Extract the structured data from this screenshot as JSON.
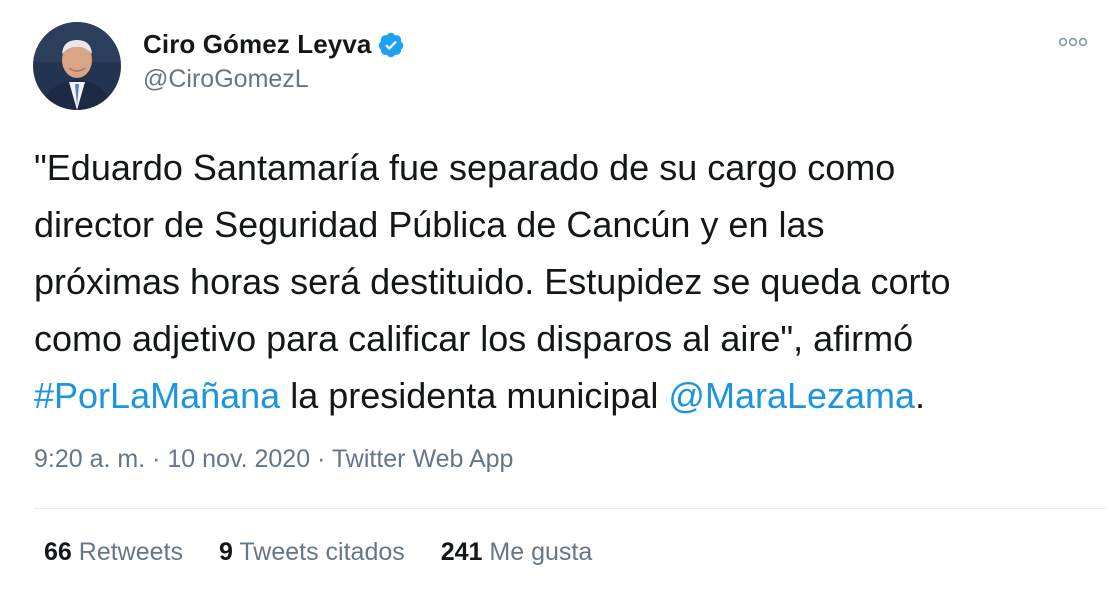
{
  "author": {
    "display_name": "Ciro Gómez Leyva",
    "handle": "@CiroGomezL",
    "verified": true
  },
  "tweet": {
    "lines": [
      [
        {
          "text": "\"Eduardo Santamaría fue separado de su cargo como",
          "link": false
        }
      ],
      [
        {
          "text": "director de Seguridad Pública de Cancún y en las",
          "link": false
        }
      ],
      [
        {
          "text": "próximas horas será destituido. Estupidez se queda corto",
          "link": false
        }
      ],
      [
        {
          "text": "como adjetivo para calificar los disparos al aire\", afirmó",
          "link": false
        }
      ],
      [
        {
          "text": "#PorLaMañana",
          "link": true
        },
        {
          "text": " la presidenta municipal ",
          "link": false
        },
        {
          "text": "@MaraLezama",
          "link": true
        },
        {
          "text": ".",
          "link": false
        }
      ]
    ]
  },
  "meta": {
    "time": "9:20 a. m.",
    "separator": " · ",
    "date": "10 nov. 2020",
    "source": "Twitter Web App"
  },
  "stats": [
    {
      "count": "66",
      "label": "Retweets"
    },
    {
      "count": "9",
      "label": "Tweets citados"
    },
    {
      "count": "241",
      "label": "Me gusta"
    }
  ],
  "icons": {
    "verified": "verified-badge-icon",
    "more": "more-options-icon"
  },
  "colors": {
    "link": "#1b95e0",
    "text": "#14171a",
    "secondary": "#657786",
    "verified": "#1da1f2",
    "divider": "#e6ecf0"
  }
}
